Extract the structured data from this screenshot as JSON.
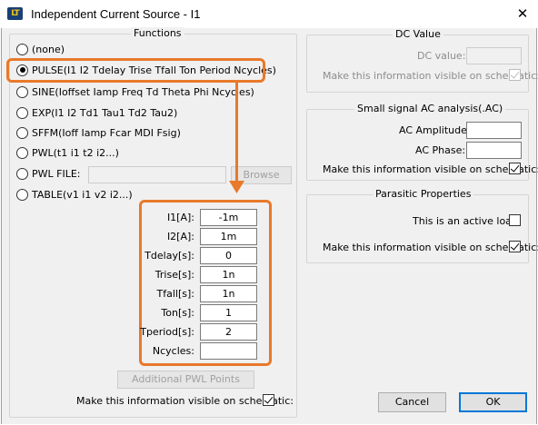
{
  "window": {
    "title": "Independent Current Source - I1",
    "icon": "ltspice-app-icon",
    "icon_text": "LT",
    "close_glyph": "✕"
  },
  "functions": {
    "title": "Functions",
    "options": [
      {
        "label": "(none)",
        "selected": false
      },
      {
        "label": "PULSE(I1 I2 Tdelay Trise Tfall Ton Period Ncycles)",
        "selected": true
      },
      {
        "label": "SINE(Ioffset Iamp Freq Td Theta Phi Ncycles)",
        "selected": false
      },
      {
        "label": "EXP(I1 I2 Td1 Tau1 Td2 Tau2)",
        "selected": false
      },
      {
        "label": "SFFM(Ioff Iamp Fcar MDI Fsig)",
        "selected": false
      },
      {
        "label": "PWL(t1 i1 t2 i2...)",
        "selected": false
      },
      {
        "label": "PWL FILE:",
        "selected": false
      },
      {
        "label": "TABLE(v1 i1 v2 i2...)",
        "selected": false
      }
    ],
    "pwl_file_value": "",
    "browse_label": "Browse",
    "params": [
      {
        "label": "I1[A]:",
        "value": "-1m"
      },
      {
        "label": "I2[A]:",
        "value": "1m"
      },
      {
        "label": "Tdelay[s]:",
        "value": "0"
      },
      {
        "label": "Trise[s]:",
        "value": "1n"
      },
      {
        "label": "Tfall[s]:",
        "value": "1n"
      },
      {
        "label": "Ton[s]:",
        "value": "1"
      },
      {
        "label": "Tperiod[s]:",
        "value": "2"
      },
      {
        "label": "Ncycles:",
        "value": ""
      }
    ],
    "additional_pwl_label": "Additional PWL Points",
    "visible_label": "Make this information visible on schematic:",
    "visible_checked": true
  },
  "dc_value": {
    "title": "DC Value",
    "dc_label": "DC value:",
    "dc_value": "",
    "visible_label": "Make this information visible on schematic:",
    "visible_checked": true
  },
  "ac_analysis": {
    "title": "Small signal AC analysis(.AC)",
    "amplitude_label": "AC Amplitude:",
    "amplitude_value": "",
    "phase_label": "AC Phase:",
    "phase_value": "",
    "visible_label": "Make this information visible on schematic:",
    "visible_checked": true
  },
  "parasitic": {
    "title": "Parasitic Properties",
    "active_load_label": "This is an active load:",
    "active_load_checked": false,
    "visible_label": "Make this information visible on schematic:",
    "visible_checked": true
  },
  "buttons": {
    "cancel": "Cancel",
    "ok": "OK"
  },
  "colors": {
    "highlight": "#e8792b",
    "default_button_border": "#0078d7",
    "dialog_background": "#f0f0f0"
  }
}
